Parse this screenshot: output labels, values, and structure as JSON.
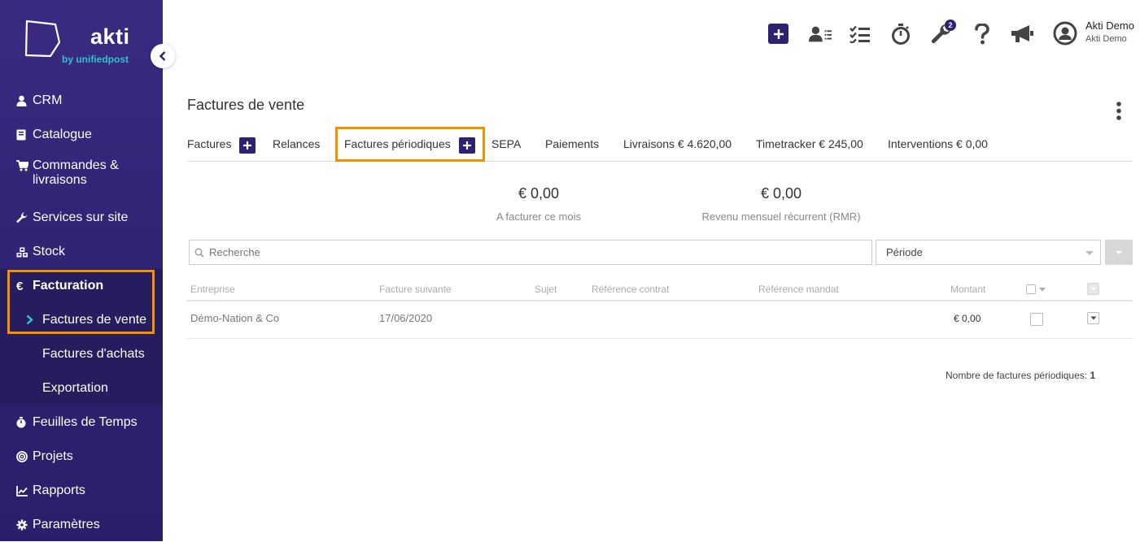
{
  "brand": {
    "name": "akti",
    "sub": "by unifiedpost"
  },
  "sidebar": {
    "items": [
      {
        "label": "CRM",
        "icon": "user-icon"
      },
      {
        "label": "Catalogue",
        "icon": "book-icon"
      },
      {
        "label": "Commandes &",
        "label2": "livraisons",
        "icon": "cart-icon"
      },
      {
        "label": "Services sur site",
        "icon": "wrench-icon"
      },
      {
        "label": "Stock",
        "icon": "cubes-icon"
      }
    ],
    "facturation": {
      "label": "Facturation",
      "icon": "euro-icon",
      "sub": [
        "Factures de vente",
        "Factures d'achats",
        "Exportation"
      ]
    },
    "bottom_items": [
      {
        "label": "Feuilles de Temps",
        "icon": "stopwatch-icon"
      },
      {
        "label": "Projets",
        "icon": "target-icon"
      },
      {
        "label": "Rapports",
        "icon": "chart-icon"
      },
      {
        "label": "Paramètres",
        "icon": "gear-icon"
      }
    ]
  },
  "topbar": {
    "badge_count": "2",
    "user_name": "Akti Demo",
    "user_company": "Akti Demo"
  },
  "page": {
    "title": "Factures de vente",
    "tabs": [
      "Factures",
      "Relances",
      "Factures périodiques",
      "SEPA",
      "Paiements",
      "Livraisons € 4.620,00",
      "Timetracker € 245,00",
      "Interventions € 0,00"
    ],
    "active_tab": "Factures périodiques"
  },
  "stats": [
    {
      "value": "€ 0,00",
      "label": "A facturer ce mois"
    },
    {
      "value": "€ 0,00",
      "label": "Revenu mensuel récurrent (RMR)"
    }
  ],
  "filters": {
    "search_placeholder": "Recherche",
    "period_label": "Période"
  },
  "table": {
    "columns": [
      "Entreprise",
      "Facture suivante",
      "Sujet",
      "Référence contrat",
      "Référence mandat",
      "Montant"
    ],
    "rows": [
      {
        "entreprise": "Démo-Nation & Co",
        "facture_suivante": "17/06/2020",
        "sujet": "",
        "ref_contrat": "",
        "ref_mandat": "",
        "montant": "€ 0,00"
      }
    ],
    "count_label": "Nombre de factures périodiques:",
    "count_value": "1"
  },
  "colors": {
    "sidebar_bg": "#2d2271",
    "accent": "#2d2271",
    "highlight": "#f39200",
    "logo_teal": "#2ec4c8"
  }
}
